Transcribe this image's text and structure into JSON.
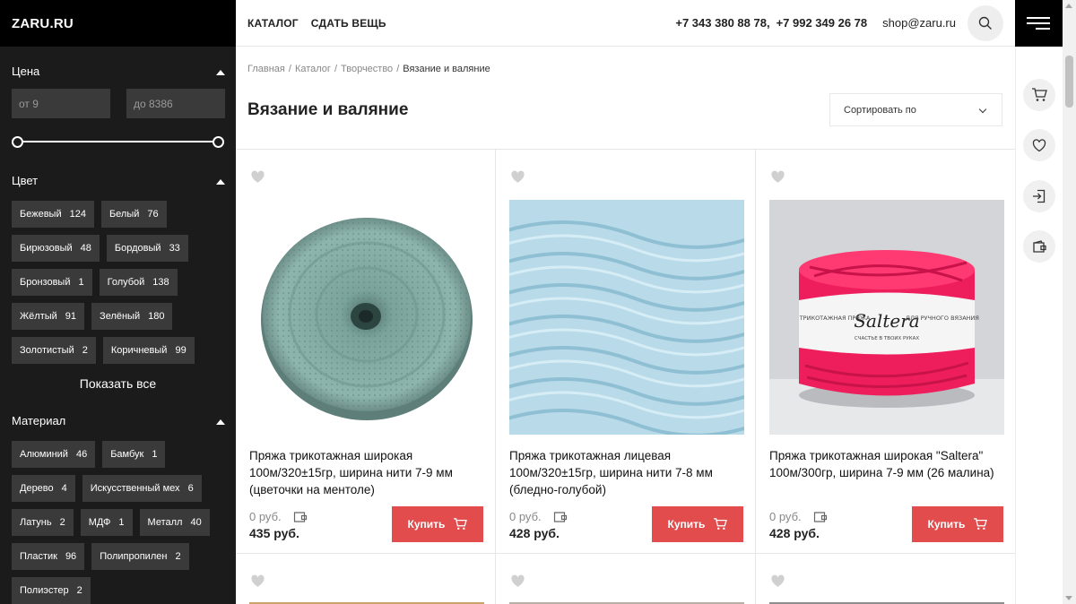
{
  "logo": "ZARU.RU",
  "nav": [
    "КАТАЛОГ",
    "СДАТЬ ВЕЩЬ"
  ],
  "header": {
    "phone1": "+7 343 380 88 78,",
    "phone2": "+7 992 349 26 78",
    "email": "shop@zaru.ru"
  },
  "filters": {
    "price": {
      "title": "Цена",
      "from_placeholder": "от 9",
      "to_placeholder": "до 8386",
      "range_fraction": [
        0,
        1
      ]
    },
    "color": {
      "title": "Цвет",
      "items": [
        {
          "label": "Бежевый",
          "count": "124"
        },
        {
          "label": "Белый",
          "count": "76"
        },
        {
          "label": "Бирюзовый",
          "count": "48"
        },
        {
          "label": "Бордовый",
          "count": "33"
        },
        {
          "label": "Бронзовый",
          "count": "1"
        },
        {
          "label": "Голубой",
          "count": "138"
        },
        {
          "label": "Жёлтый",
          "count": "91"
        },
        {
          "label": "Зелёный",
          "count": "180"
        },
        {
          "label": "Золотистый",
          "count": "2"
        },
        {
          "label": "Коричневый",
          "count": "99"
        }
      ],
      "show_all": "Показать все"
    },
    "material": {
      "title": "Материал",
      "items": [
        {
          "label": "Алюминий",
          "count": "46"
        },
        {
          "label": "Бамбук",
          "count": "1"
        },
        {
          "label": "Дерево",
          "count": "4"
        },
        {
          "label": "Искусственный мех",
          "count": "6"
        },
        {
          "label": "Латунь",
          "count": "2"
        },
        {
          "label": "МДФ",
          "count": "1"
        },
        {
          "label": "Металл",
          "count": "40"
        },
        {
          "label": "Пластик",
          "count": "96"
        },
        {
          "label": "Полипропилен",
          "count": "2"
        },
        {
          "label": "Полиэстер",
          "count": "2"
        }
      ]
    }
  },
  "breadcrumb": [
    "Главная",
    "Каталог",
    "Творчество",
    "Вязание и валяние"
  ],
  "page_title": "Вязание и валяние",
  "sort_label": "Сортировать по",
  "products": [
    {
      "title": "Пряжа трикотажная широкая 100м/320±15гр, ширина нити 7-9 мм (цветочки на ментоле)",
      "old_price": "0 руб.",
      "price": "435 руб.",
      "buy": "Купить"
    },
    {
      "title": "Пряжа трикотажная лицевая 100м/320±15гр, ширина нити 7-8 мм (бледно-голубой)",
      "old_price": "0 руб.",
      "price": "428 руб.",
      "buy": "Купить"
    },
    {
      "title": "Пряжа трикотажная широкая \"Saltera\" 100м/300гр, ширина 7-9 мм (26 малина)",
      "old_price": "0 руб.",
      "price": "428 руб.",
      "buy": "Купить",
      "label_text": "Saltera",
      "label_left": "ТРИКОТАЖНАЯ ПРЯЖА",
      "label_right": "ДЛЯ РУЧНОГО ВЯЗАНИЯ",
      "label_sub": "СЧАСТЬЕ В ТВОИХ РУКАХ"
    }
  ],
  "colors": {
    "accent": "#e24c4c",
    "sidebar": "#1b1b1b",
    "tag": "#3a3a3a"
  },
  "icons": {
    "search": "search-icon",
    "cart": "cart-icon",
    "favorite": "heart-icon",
    "login": "login-icon",
    "wallet": "wallet-icon",
    "menu": "burger-menu-icon"
  }
}
